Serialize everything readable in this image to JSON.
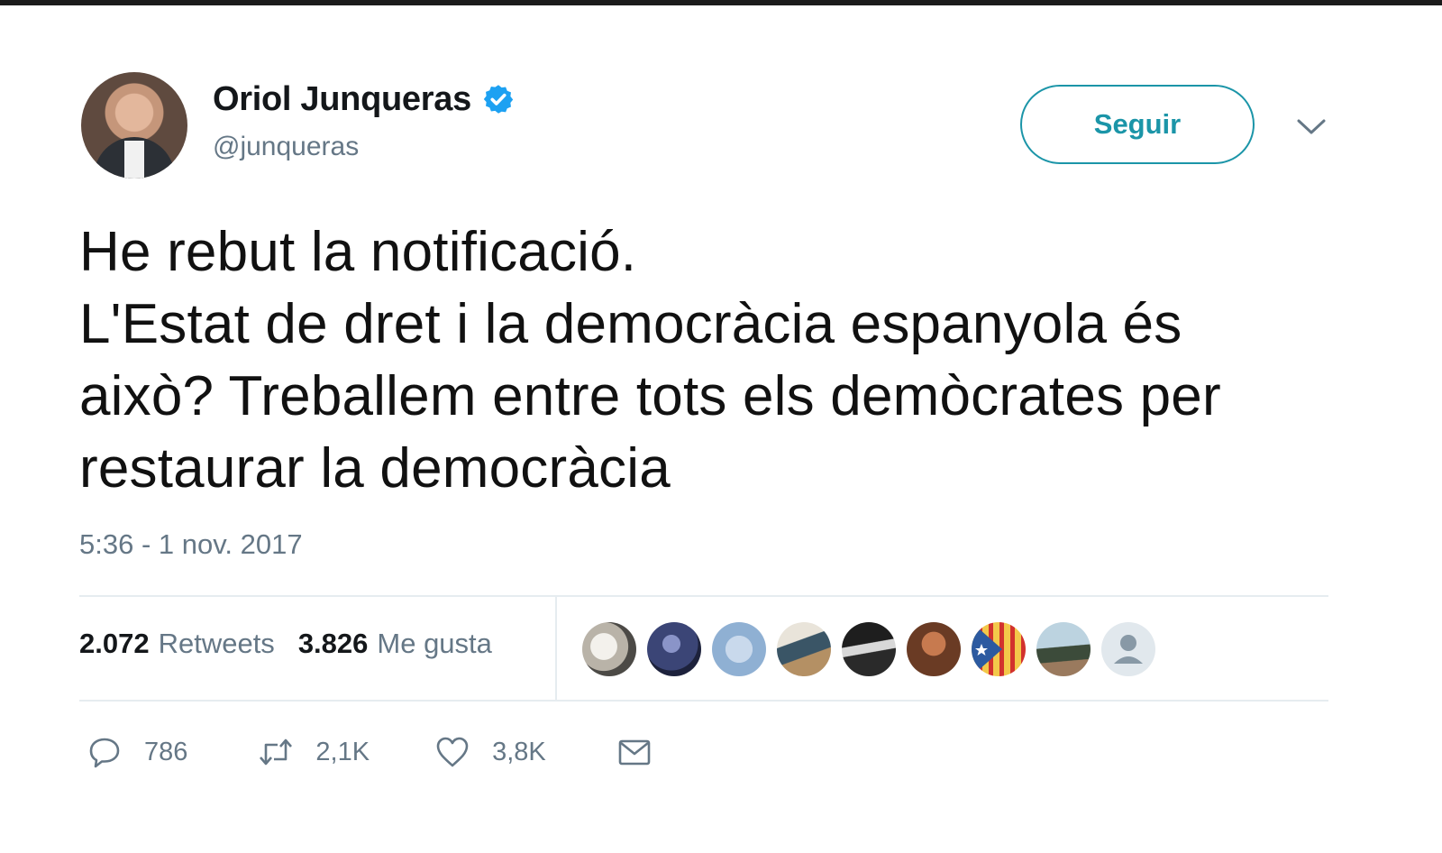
{
  "user": {
    "display_name": "Oriol Junqueras",
    "handle": "@junqueras",
    "verified": true
  },
  "follow_button": {
    "label": "Seguir"
  },
  "tweet": {
    "lines": [
      "He rebut la notificació.",
      "L'Estat de dret i la democràcia espanyola és",
      "això? Treballem entre tots els demòcrates per",
      "restaurar la democràcia"
    ],
    "timestamp": "5:36 - 1 nov. 2017"
  },
  "stats": {
    "retweets_count": "2.072",
    "retweets_label": "Retweets",
    "likes_count": "3.826",
    "likes_label": "Me gusta"
  },
  "likers": [
    {
      "icon": "liker-avatar-1"
    },
    {
      "icon": "liker-avatar-2"
    },
    {
      "icon": "liker-avatar-3"
    },
    {
      "icon": "liker-avatar-4"
    },
    {
      "icon": "liker-avatar-5"
    },
    {
      "icon": "liker-avatar-6"
    },
    {
      "icon": "estelada-flag-avatar"
    },
    {
      "icon": "liker-avatar-8"
    },
    {
      "icon": "default-avatar-icon"
    }
  ],
  "actions": {
    "reply_count": "786",
    "retweet_count": "2,1K",
    "like_count": "3,8K"
  },
  "colors": {
    "accent": "#1b95a8",
    "verified": "#1da1f2",
    "muted": "#657786",
    "divider": "#e6ecf0"
  }
}
